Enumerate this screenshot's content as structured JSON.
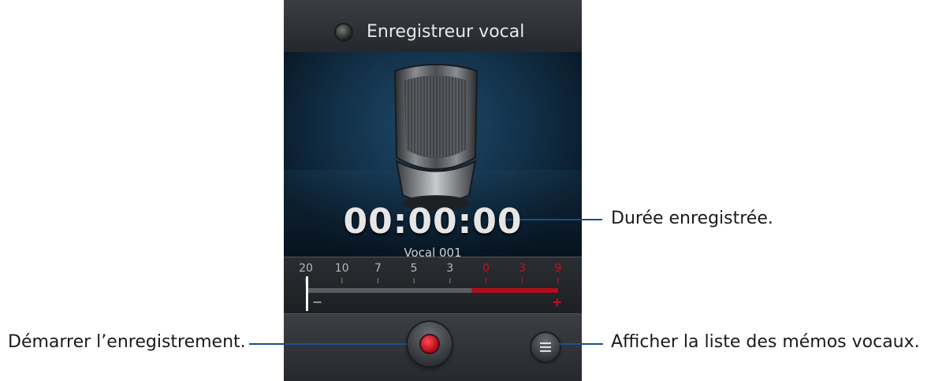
{
  "app": {
    "title": "Enregistreur vocal"
  },
  "recorder": {
    "timer": "00:00:00",
    "filename": "Vocal 001"
  },
  "meter": {
    "scale_labels": [
      "20",
      "10",
      "7",
      "5",
      "3",
      "0",
      "3",
      "9"
    ],
    "scale_red_from_index": 5,
    "minus_symbol": "−",
    "plus_symbol": "+",
    "level_fraction": 0,
    "normal_color": "#5a5d61",
    "peak_color": "#b00e1a"
  },
  "controls": {
    "record_icon": "record-icon",
    "list_icon": "list-icon",
    "record_color": "#c8101e"
  },
  "callouts": {
    "duration": "Durée enregistrée.",
    "start": "Démarrer l’enregistrement.",
    "list": "Afficher la liste des mémos vocaux.",
    "line_color": "#1a4e8a"
  }
}
